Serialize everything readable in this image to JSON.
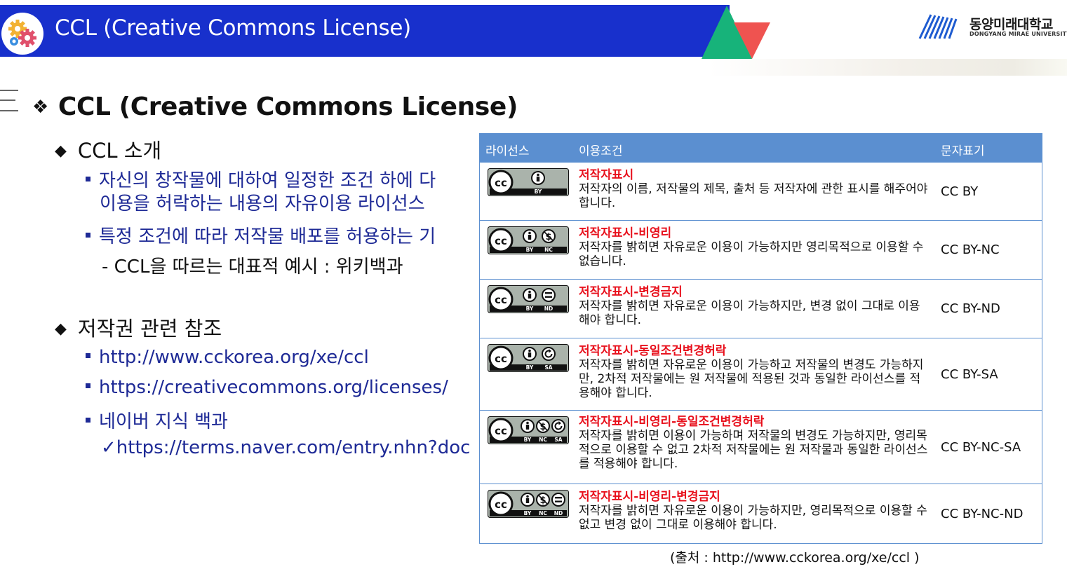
{
  "header": {
    "title": "CCL (Creative Commons License)",
    "logo_icon": "gears-icon",
    "university_ko": "동양미래대학교",
    "university_en": "DONGYANG MIRAE UNIVERSITY",
    "colors": {
      "bar": "#1830cc",
      "tri_green": "#17b37a",
      "tri_red": "#ef5350",
      "table_header": "#5b8fd0",
      "license_name": "#e8101c"
    }
  },
  "section_title": "CCL (Creative Commons License)",
  "left": {
    "intro_heading": "CCL 소개",
    "intro_items": [
      "자신의 창작물에 대하여 일정한 조건 하에 다",
      "이용을 허락하는 내용의 자유이용 라이선스",
      "특정 조건에 따라 저작물 배포를 허용하는 기"
    ],
    "intro_example": "- CCL을 따르는 대표적 예시 : 위키백과",
    "ref_heading": "저작권 관련 참조",
    "ref_items": [
      "http://www.cckorea.org/xe/ccl",
      "https://creativecommons.org/licenses/",
      "네이버 지식 백과"
    ],
    "ref_sub": "✓https://terms.naver.com/entry.nhn?doc"
  },
  "table": {
    "headers": [
      "라이선스",
      "이용조건",
      "문자표기"
    ],
    "rows": [
      {
        "badge": [
          "BY"
        ],
        "name": "저작자표시",
        "desc": "저작자의 이름, 저작물의 제목, 출처 등 저작자에 관한 표시를 해주어야 합니다.",
        "code": "CC BY"
      },
      {
        "badge": [
          "BY",
          "NC"
        ],
        "name": "저작자표시-비영리",
        "desc": "저작자를 밝히면 자유로운 이용이 가능하지만 영리목적으로 이용할 수 없습니다.",
        "code": "CC BY-NC"
      },
      {
        "badge": [
          "BY",
          "ND"
        ],
        "name": "저작자표시-변경금지",
        "desc": "저작자를 밝히면 자유로운 이용이 가능하지만, 변경 없이 그대로 이용해야 합니다.",
        "code": "CC BY-ND"
      },
      {
        "badge": [
          "BY",
          "SA"
        ],
        "name": "저작자표시-동일조건변경허락",
        "desc": "저작자를 밝히면 자유로운 이용이 가능하고 저작물의 변경도 가능하지만, 2차적 저작물에는 원 저작물에 적용된 것과 동일한 라이선스를 적용해야 합니다.",
        "code": "CC BY-SA"
      },
      {
        "badge": [
          "BY",
          "NC",
          "SA"
        ],
        "name": "저작자표시-비영리-동일조건변경허락",
        "desc": "저작자를 밝히면 이용이 가능하며 저작물의 변경도 가능하지만, 영리목적으로 이용할 수 없고 2차적 저작물에는 원 저작물과 동일한 라이선스를 적용해야 합니다.",
        "code": "CC BY-NC-SA"
      },
      {
        "badge": [
          "BY",
          "NC",
          "ND"
        ],
        "name": "저작자표시-비영리-변경금지",
        "desc": "저작자를 밝히면 자유로운 이용이 가능하지만, 영리목적으로 이용할 수 없고 변경 없이 그대로 이용해야 합니다.",
        "code": "CC BY-NC-ND"
      }
    ]
  },
  "source": "(출처 : http://www.cckorea.org/xe/ccl )"
}
